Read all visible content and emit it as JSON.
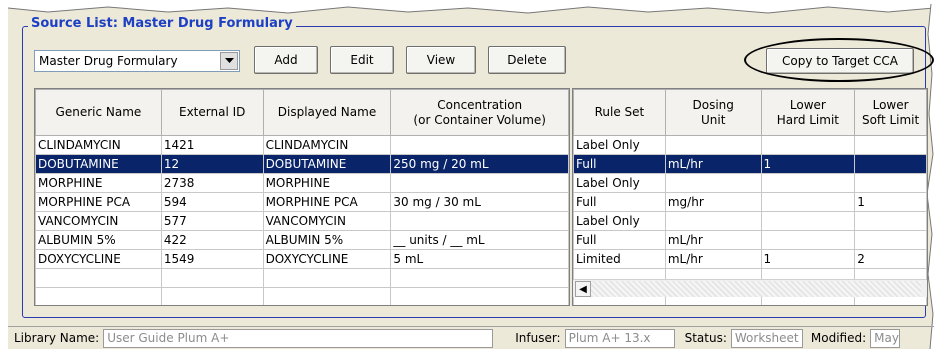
{
  "group_title": "Source List: Master Drug Formulary",
  "toolbar": {
    "list_select_value": "Master Drug Formulary",
    "add_label": "Add",
    "edit_label": "Edit",
    "view_label": "View",
    "delete_label": "Delete",
    "copy_label": "Copy to Target CCA"
  },
  "left_table": {
    "headers": [
      "Generic Name",
      "External ID",
      "Displayed Name",
      "Concentration\n(or Container Volume)"
    ],
    "rows": [
      [
        "CLINDAMYCIN",
        "1421",
        "CLINDAMYCIN",
        ""
      ],
      [
        "DOBUTAMINE",
        "12",
        "DOBUTAMINE",
        "250 mg / 20 mL"
      ],
      [
        "MORPHINE",
        "2738",
        "MORPHINE",
        ""
      ],
      [
        "MORPHINE PCA",
        "594",
        "MORPHINE PCA",
        "30 mg / 30 mL"
      ],
      [
        "VANCOMYCIN",
        "577",
        "VANCOMYCIN",
        ""
      ],
      [
        "ALBUMIN 5%",
        "422",
        "ALBUMIN 5%",
        "__ units / __ mL"
      ],
      [
        "DOXYCYCLINE",
        "1549",
        "DOXYCYCLINE",
        "5 mL"
      ]
    ]
  },
  "right_table": {
    "headers": [
      "Rule Set",
      "Dosing\nUnit",
      "Lower\nHard Limit",
      "Lower\nSoft Limit"
    ],
    "rows": [
      [
        "Label Only",
        "",
        "",
        ""
      ],
      [
        "Full",
        "mL/hr",
        "1",
        ""
      ],
      [
        "Label Only",
        "",
        "",
        ""
      ],
      [
        "Full",
        "mg/hr",
        "",
        "1"
      ],
      [
        "Label Only",
        "",
        "",
        ""
      ],
      [
        "Full",
        "mL/hr",
        "",
        ""
      ],
      [
        "Limited",
        "mL/hr",
        "1",
        "2"
      ]
    ]
  },
  "selected_row_index": 1,
  "status": {
    "library_label": "Library Name:",
    "library_value": "User Guide Plum A+",
    "infuser_label": "Infuser:",
    "infuser_value": "Plum A+ 13.x",
    "status_label": "Status:",
    "status_value": "Worksheet",
    "modified_label": "Modified:",
    "modified_value": "May"
  },
  "colors": {
    "title": "#1d3fc4",
    "selection": "#0a246a",
    "window_bg": "#ece9d8"
  },
  "icons": {
    "dropdown": "chevron-down-icon",
    "scroll_left": "scroll-left-icon"
  }
}
